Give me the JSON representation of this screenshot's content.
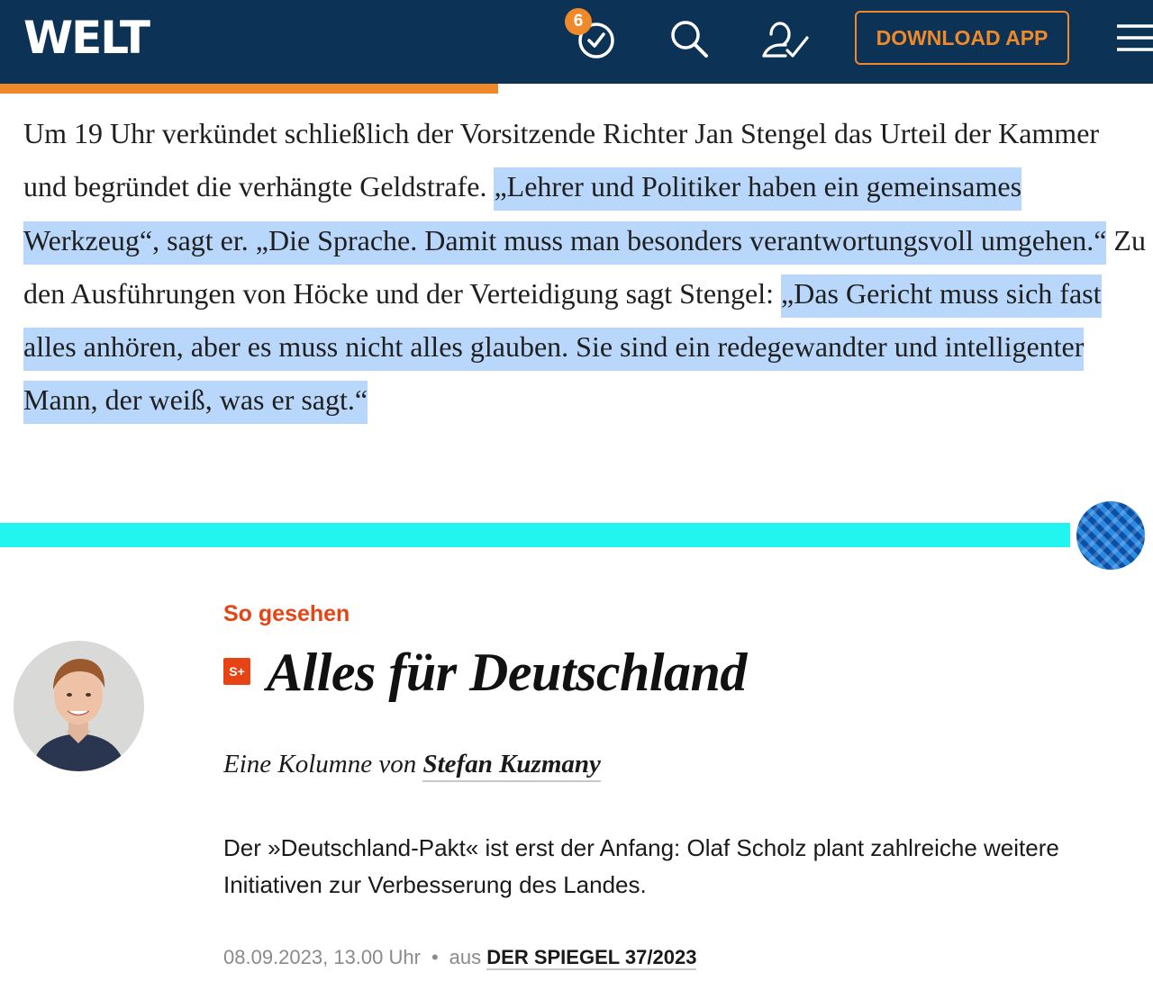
{
  "welt_header": {
    "logo": "WELT",
    "notification_count": "6",
    "download_label": "DOWNLOAD APP",
    "icons": [
      "clock-check-icon",
      "search-icon",
      "account-check-icon",
      "menu-icon"
    ],
    "colors": {
      "header_bg": "#0c3356",
      "accent": "#f0892a"
    },
    "reading_progress_percent": 43
  },
  "welt_article": {
    "segments": [
      {
        "text": "Um 19 Uhr verkündet schließlich der Vorsitzende Richter Jan Stengel das Urteil der Kammer und begründet die verhängte Geldstrafe. ",
        "highlighted": false
      },
      {
        "text": "„Lehrer und Politiker haben ein gemeinsames Werkzeug“, sagt er. „Die Sprache. Damit muss man besonders verantwortungsvoll umgehen.“",
        "highlighted": true
      },
      {
        "text": " Zu den Ausführungen von Höcke und der Verteidigung sagt Stengel: ",
        "highlighted": false
      },
      {
        "text": "„Das Gericht muss sich fast alles anhören, aber es muss nicht alles glauben. Sie sind ein redegewandter und intelligenter Mann, der weiß, was er sagt.“",
        "highlighted": true
      }
    ],
    "highlight_color": "#b8d7fb"
  },
  "spiegel": {
    "divider_color": "#22f5f0",
    "rubric": "So gesehen",
    "badge": "S+",
    "headline": "Alles für Deutschland",
    "byline_prefix": "Eine Kolumne von",
    "author": "Stefan Kuzmany",
    "teaser": "Der »Deutschland-Pakt« ist erst der Anfang: Olaf Scholz plant zahlreiche weitere Initiativen zur Verbesserung des Landes.",
    "date": "08.09.2023, 13.00 Uhr",
    "separator": "•",
    "source_prefix": "aus",
    "issue": "DER SPIEGEL 37/2023",
    "accent": "#e64415"
  }
}
